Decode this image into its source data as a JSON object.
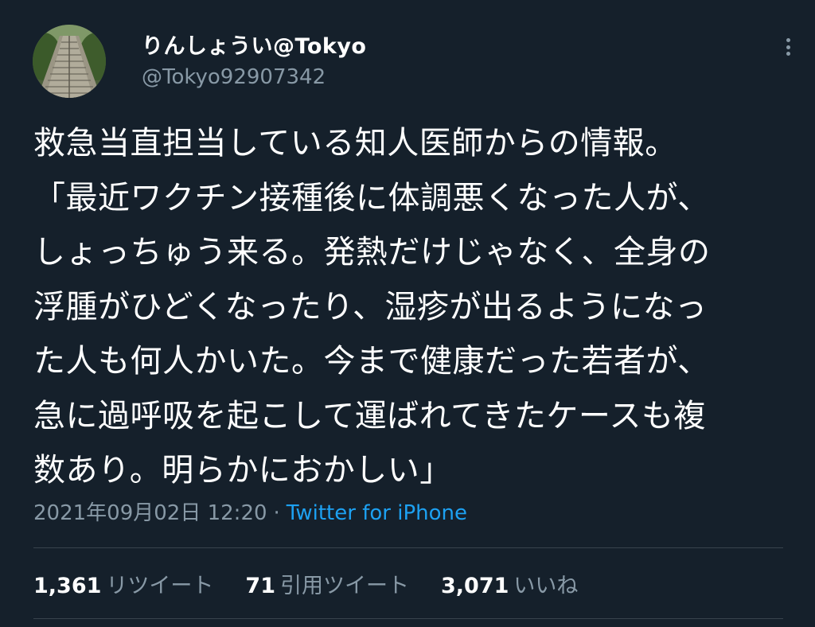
{
  "user": {
    "display_name": "りんしょうい@Tokyo",
    "handle": "@Tokyo92907342"
  },
  "tweet": {
    "lines": [
      "救急当直担当している知人医師からの情報。",
      "「最近ワクチン接種後に体調悪くなった人が、",
      "しょっちゅう来る。発熱だけじゃなく、全身の",
      "浮腫がひどくなったり、湿疹が出るようになっ",
      "た人も何人かいた。今まで健康だった若者が、",
      "急に過呼吸を起こして運ばれてきたケースも複",
      "数あり。明らかにおかしい」"
    ],
    "timestamp": "2021年09月02日 12:20",
    "separator": "·",
    "source": "Twitter for iPhone"
  },
  "stats": {
    "retweets_count": "1,361",
    "retweets_label": "リツイート",
    "quotes_count": "71",
    "quotes_label": "引用ツイート",
    "likes_count": "3,071",
    "likes_label": "いいね"
  },
  "icons": {
    "more": "more-options-icon"
  },
  "colors": {
    "background": "#15202b",
    "text": "#ffffff",
    "secondary": "#8899a6",
    "accent": "#1da1f2",
    "divider": "#38444d"
  }
}
